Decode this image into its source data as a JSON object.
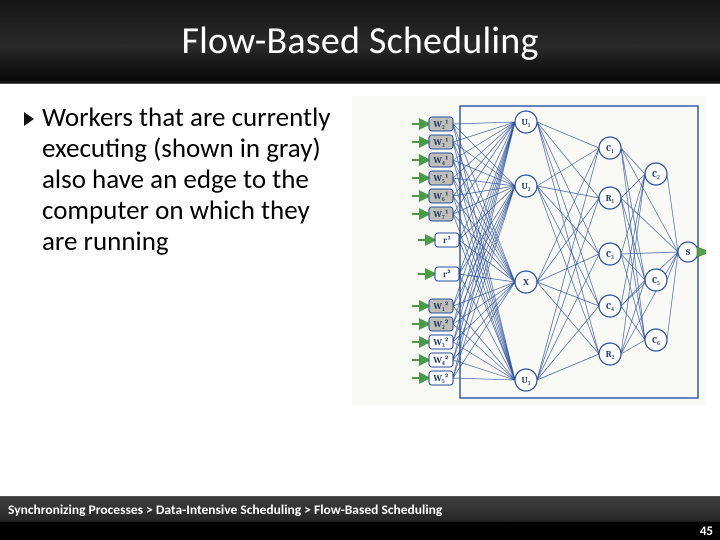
{
  "title": "Flow-Based Scheduling",
  "bullet_text": "Workers that are currently executing (shown in gray) also have an edge to the computer on which they are running",
  "breadcrumb": "Synchronizing Processes > Data-Intensive Scheduling > Flow-Based Scheduling",
  "page_number": "45",
  "diagram": {
    "workers_j1_gray": [
      "W₂¹",
      "W₃¹",
      "W₄¹",
      "W₅¹",
      "W₆¹",
      "W₇¹"
    ],
    "r_nodes": [
      "r¹",
      "r²"
    ],
    "workers_j2_gray": [
      "W₁²",
      "W₂²"
    ],
    "workers_j2_white": [
      "W₃²",
      "W₄²",
      "W₅²"
    ],
    "u_nodes": [
      "U₁",
      "U₂",
      "X",
      "U₃"
    ],
    "c_col1": [
      "C₁",
      "R₁",
      "C₃",
      "C₄",
      "R₂"
    ],
    "c_col2": [
      "C₂",
      "C₅",
      "C₆"
    ],
    "sink": "S"
  }
}
